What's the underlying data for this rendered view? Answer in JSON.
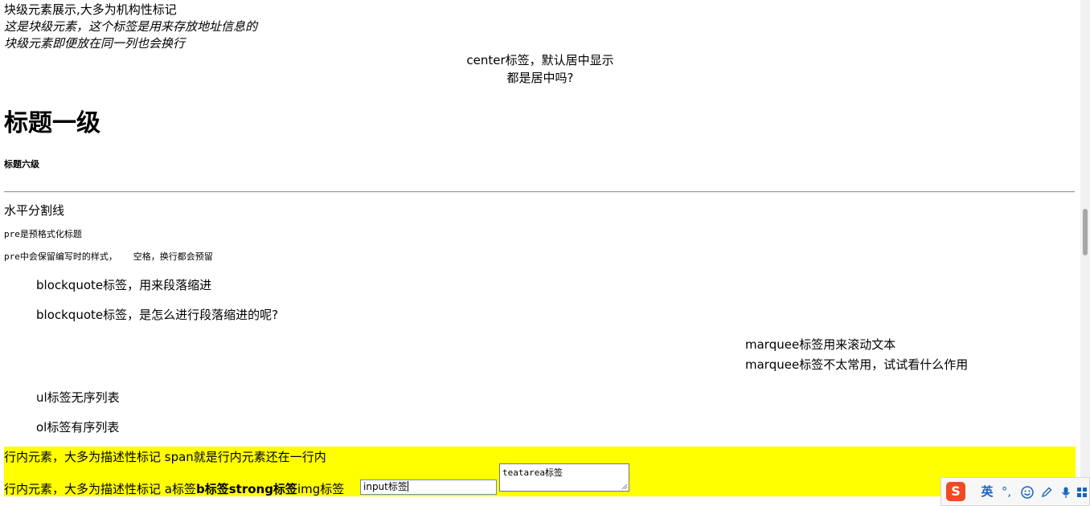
{
  "block": {
    "line1": "块级元素展示,大多为机构性标记",
    "address1": "这是块级元素，这个标签是用来存放地址信息的",
    "address2": "块级元素即便放在同一列也会换行",
    "center1": "center标签，默认居中显示",
    "center2": "都是居中吗?",
    "h1": "标题一级",
    "h6": "标题六级",
    "hr_text": "水平分割线",
    "pre1": "pre是预格式化标题",
    "pre2": "pre中会保留编写时的样式，   空格，换行都会预留",
    "blockquote1": "blockquote标签，用来段落缩进",
    "blockquote2": "blockquote标签，是怎么进行段落缩进的呢?",
    "marquee1": "marquee标签用来滚动文本",
    "marquee2": "marquee标签不太常用，试试看什么作用",
    "ul_item": "ul标签无序列表",
    "ol_item": "ol标签有序列表"
  },
  "inline": {
    "line1": "行内元素，大多为描述性标记 span就是行内元素还在一行内",
    "line2_prefix": "行内元素，大多为描述性标记 a标签",
    "b_text": "b标签",
    "strong_text": "strong标签",
    "img_text": "img标签",
    "input_value": "input标签",
    "textarea_value": "teatarea标签",
    "highlight_color": "#ffff00"
  },
  "ime": {
    "logo": "S",
    "lang": "英",
    "punct": "°,",
    "emoji_icon": "smile-icon",
    "pen_icon": "pen-icon",
    "mic_icon": "microphone-icon",
    "grid_icon": "grid-icon"
  }
}
